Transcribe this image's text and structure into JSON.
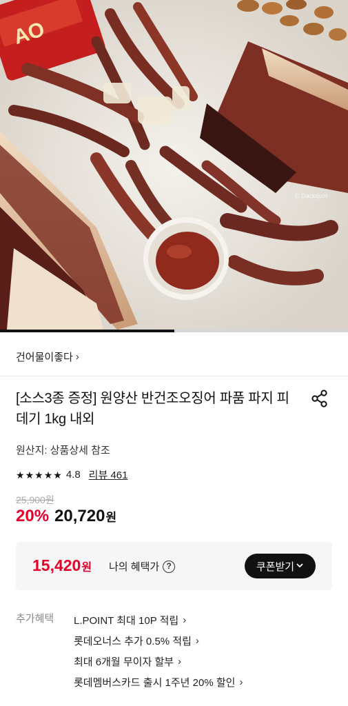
{
  "hero": {
    "watermark": "© Dackrjum",
    "can_text": "AO",
    "carousel_progress": 0.5
  },
  "brand": {
    "name": "건어물이좋다",
    "chevron": "›"
  },
  "product": {
    "title": "[소스3종 증정] 원양산 반건조오징어 파품 파지 피데기 1kg 내외",
    "origin": "원산지: 상품상세 참조",
    "rating": {
      "stars": 5,
      "star_glyph": "★",
      "score": "4.8",
      "review_label": "리뷰 461"
    },
    "original_price": "25,900원",
    "discount": "20%",
    "price": "20,720",
    "price_unit": "원"
  },
  "benefit": {
    "price": "15,420",
    "unit": "원",
    "label": "나의 혜택가",
    "help": "?",
    "coupon_button": "쿠폰받기",
    "coupon_chevron": "⌄"
  },
  "extra": {
    "label": "추가혜택",
    "items": [
      {
        "text": "L.POINT 최대 10P 적립",
        "chevron": "›"
      },
      {
        "text": "롯데오너스 추가 0.5% 적립",
        "chevron": "›"
      },
      {
        "text": "최대 6개월 무이자 할부",
        "chevron": "›"
      },
      {
        "text": "롯데멤버스카드 출시 1주년 20% 할인",
        "chevron": "›"
      }
    ]
  },
  "colors": {
    "accent": "#e4002b",
    "text": "#111111",
    "muted": "#888888",
    "box": "#f6f6f6"
  }
}
